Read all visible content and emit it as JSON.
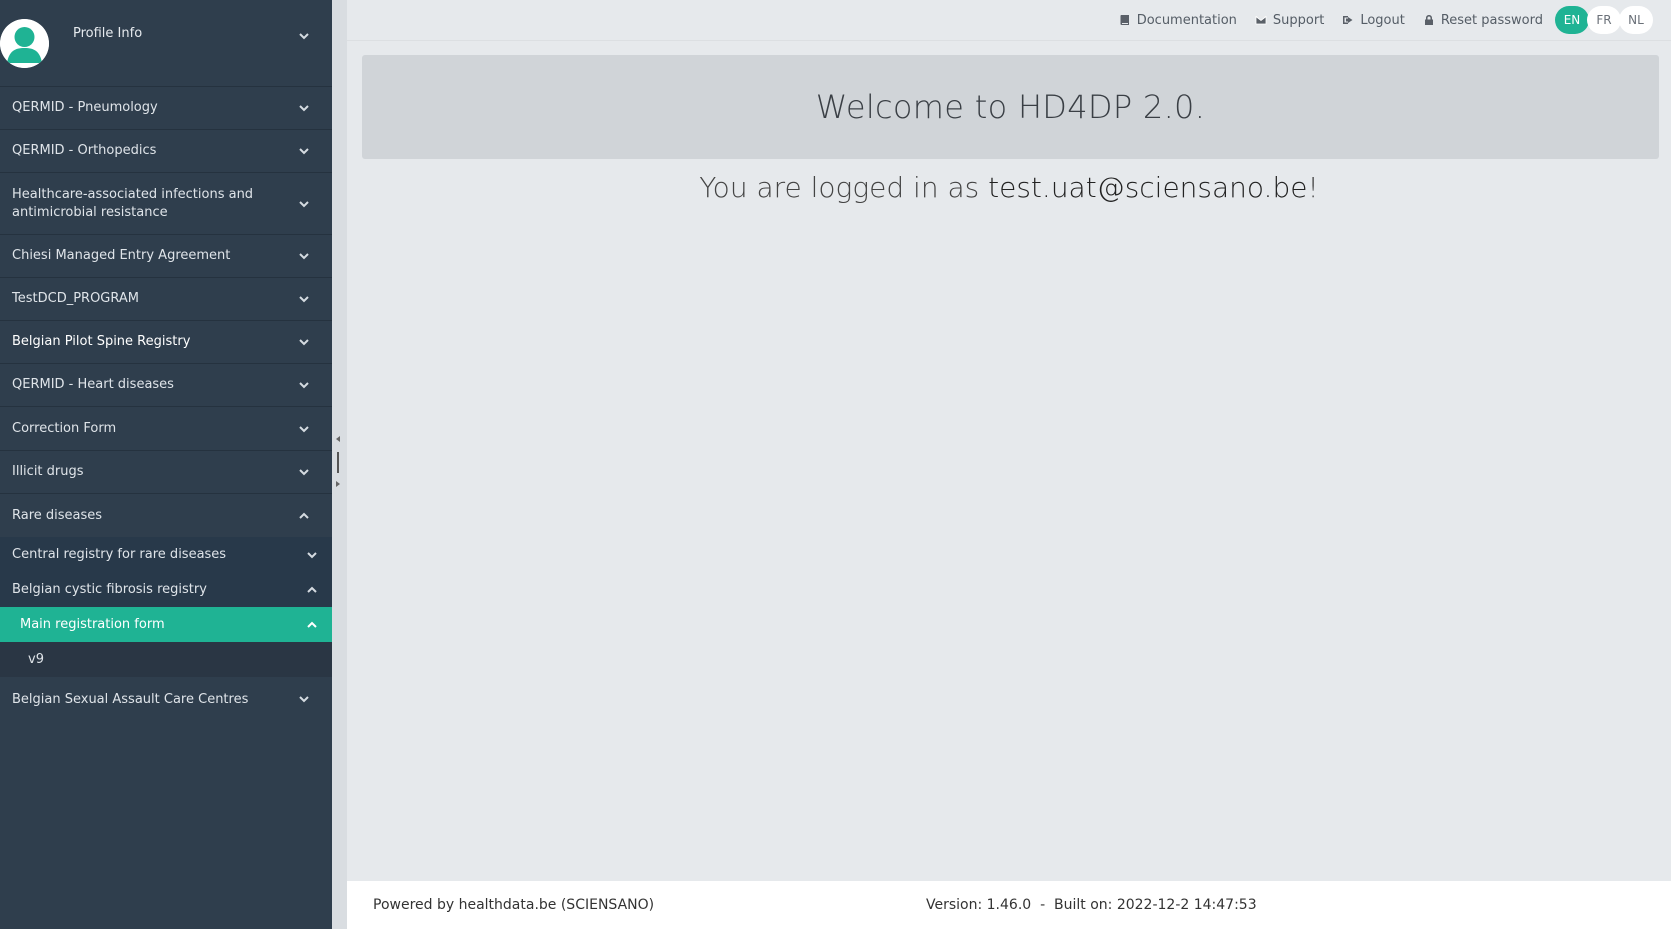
{
  "profile": {
    "label": "Profile Info"
  },
  "sidebar": {
    "items": [
      {
        "label": "QERMID - Pneumology",
        "h": 43
      },
      {
        "label": "QERMID - Orthopedics",
        "h": 43
      },
      {
        "label": "Healthcare-associated infections and antimicrobial resistance",
        "h": 62
      },
      {
        "label": "Chiesi Managed Entry Agreement",
        "h": 43
      },
      {
        "label": "TestDCD_PROGRAM",
        "h": 43
      },
      {
        "label": "Belgian Pilot Spine Registry",
        "h": 43
      },
      {
        "label": "QERMID - Heart diseases",
        "h": 43
      },
      {
        "label": "Correction Form",
        "h": 44
      },
      {
        "label": "Illicit drugs",
        "h": 43
      },
      {
        "label": "Rare diseases",
        "h": 44
      }
    ],
    "rare_sub": {
      "central": "Central registry for rare diseases",
      "cystic": "Belgian cystic fibrosis registry",
      "main_form": "Main registration form",
      "version": "v9"
    },
    "last_item": "Belgian Sexual Assault Care Centres"
  },
  "topbar": {
    "documentation": "Documentation",
    "support": "Support",
    "logout": "Logout",
    "reset": "Reset password",
    "langs": [
      "EN",
      "FR",
      "NL"
    ],
    "active_lang": "EN"
  },
  "main": {
    "welcome": "Welcome to HD4DP 2.0.",
    "logged_prefix": "You are logged in as ",
    "email": "test.uat@sciensano.be",
    "logged_suffix": "!"
  },
  "footer": {
    "powered": "Powered by healthdata.be (SCIENSANO)",
    "version": "Version: 1.46.0  -  Built on: 2022-12-2 14:47:53"
  },
  "colors": {
    "sidebar_bg": "#2f3e4d",
    "accent": "#1fb394",
    "welcome_bg": "#d0d4d8"
  }
}
